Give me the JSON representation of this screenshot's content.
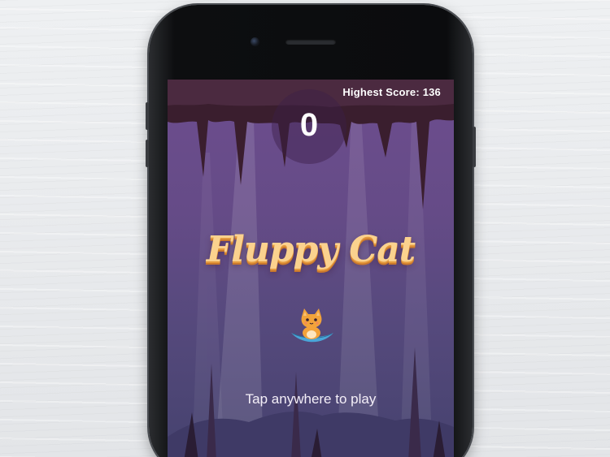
{
  "game": {
    "title": "Fluppy Cat",
    "score": "0",
    "highest_score_label": "Highest Score: 136",
    "prompt": "Tap anywhere to play"
  },
  "icons": {
    "player": "cat-on-leaf-icon"
  },
  "colors": {
    "sky_top": "#6d4d8e",
    "sky_bottom": "#45426e",
    "cave_ceiling": "#3a1e2e",
    "title_fill": "#fbd28e",
    "title_shadow": "#c9782d",
    "cat": "#f2a33a",
    "leaf": "#4aa6d8"
  }
}
